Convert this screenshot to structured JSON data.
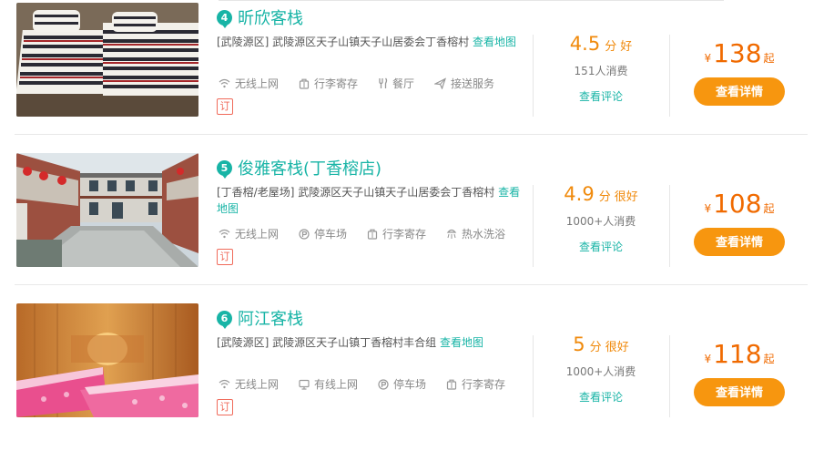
{
  "colors": {
    "accent": "#18b4a6",
    "score": "#f08a0c",
    "price": "#f06a00",
    "button": "#f7960f"
  },
  "hotels": [
    {
      "number": "4",
      "name": "昕欣客栈",
      "address": "[武陵源区] 武陵源区天子山镇天子山居委会丁香榕村",
      "map_link": "查看地图",
      "amenities": [
        {
          "icon": "wifi-icon",
          "label": "无线上网"
        },
        {
          "icon": "luggage-icon",
          "label": "行李寄存"
        },
        {
          "icon": "restaurant-icon",
          "label": "餐厅"
        },
        {
          "icon": "plane-icon",
          "label": "接送服务"
        }
      ],
      "book_tag": "订",
      "score": "4.5",
      "score_unit": "分",
      "score_word": "好",
      "consumers": "151人消费",
      "reviews_link": "查看评论",
      "currency": "¥",
      "price": "138",
      "price_suffix": "起",
      "detail_button": "查看详情"
    },
    {
      "number": "5",
      "name": "俊雅客栈(丁香榕店)",
      "address": "[丁香榕/老屋场] 武陵源区天子山镇天子山居委会丁香榕村",
      "map_link": "查看地图",
      "amenities": [
        {
          "icon": "wifi-icon",
          "label": "无线上网"
        },
        {
          "icon": "parking-icon",
          "label": "停车场"
        },
        {
          "icon": "luggage-icon",
          "label": "行李寄存"
        },
        {
          "icon": "shower-icon",
          "label": "热水洗浴"
        }
      ],
      "book_tag": "订",
      "score": "4.9",
      "score_unit": "分",
      "score_word": "很好",
      "consumers": "1000+人消费",
      "reviews_link": "查看评论",
      "currency": "¥",
      "price": "108",
      "price_suffix": "起",
      "detail_button": "查看详情"
    },
    {
      "number": "6",
      "name": "阿江客栈",
      "address": "[武陵源区] 武陵源区天子山镇丁香榕村丰合组",
      "map_link": "查看地图",
      "amenities": [
        {
          "icon": "wifi-icon",
          "label": "无线上网"
        },
        {
          "icon": "computer-icon",
          "label": "有线上网"
        },
        {
          "icon": "parking-icon",
          "label": "停车场"
        },
        {
          "icon": "luggage-icon",
          "label": "行李寄存"
        }
      ],
      "book_tag": "订",
      "score": "5",
      "score_unit": "分",
      "score_word": "很好",
      "consumers": "1000+人消费",
      "reviews_link": "查看评论",
      "currency": "¥",
      "price": "118",
      "price_suffix": "起",
      "detail_button": "查看详情"
    }
  ]
}
